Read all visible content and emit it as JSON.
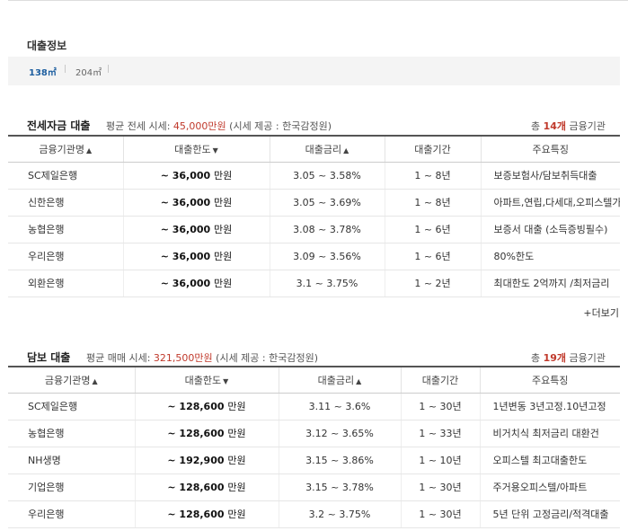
{
  "loan_info": {
    "title": "대출정보",
    "sizes": [
      "138㎡",
      "204㎡"
    ],
    "separator": "|"
  },
  "jeonse": {
    "title": "전세자금 대출",
    "avg_prefix": "평균 전세 시세:",
    "avg_price": "45,000만원",
    "source": "(시세 제공 : 한국감정원)",
    "count_prefix": "총",
    "count": "14개",
    "count_suffix": "금융기관",
    "headers": [
      "금융기관명",
      "대출한도",
      "대출금리",
      "대출기간",
      "주요특징"
    ],
    "rows": [
      {
        "bank": "SC제일은행",
        "limit": "~ 36,000",
        "unit": "만원",
        "rate": "3.05 ~ 3.58%",
        "period": "1 ~ 8년",
        "feature": "보증보험사/담보취득대출"
      },
      {
        "bank": "신한은행",
        "limit": "~ 36,000",
        "unit": "만원",
        "rate": "3.05 ~ 3.69%",
        "period": "1 ~ 8년",
        "feature": "아파트,연립,다세대,오피스텔가능"
      },
      {
        "bank": "농협은행",
        "limit": "~ 36,000",
        "unit": "만원",
        "rate": "3.08 ~ 3.78%",
        "period": "1 ~ 6년",
        "feature": "보증서 대출 (소득증빙필수)"
      },
      {
        "bank": "우리은행",
        "limit": "~ 36,000",
        "unit": "만원",
        "rate": "3.09 ~ 3.56%",
        "period": "1 ~ 6년",
        "feature": "80%한도"
      },
      {
        "bank": "외환은행",
        "limit": "~ 36,000",
        "unit": "만원",
        "rate": "3.1 ~ 3.75%",
        "period": "1 ~ 2년",
        "feature": "최대한도 2억까지 /최저금리"
      }
    ],
    "more": "+더보기"
  },
  "mortgage": {
    "title": "담보 대출",
    "avg_prefix": "평균 매매 시세:",
    "avg_price": "321,500만원",
    "source": "(시세 제공 : 한국감정원)",
    "count_prefix": "총",
    "count": "19개",
    "count_suffix": "금융기관",
    "headers": [
      "금융기관명",
      "대출한도",
      "대출금리",
      "대출기간",
      "주요특징"
    ],
    "rows": [
      {
        "bank": "SC제일은행",
        "limit": "~ 128,600",
        "unit": "만원",
        "rate": "3.11 ~ 3.6%",
        "period": "1 ~ 30년",
        "feature": "1년변동 3년고정.10년고정"
      },
      {
        "bank": "농협은행",
        "limit": "~ 128,600",
        "unit": "만원",
        "rate": "3.12 ~ 3.65%",
        "period": "1 ~ 33년",
        "feature": "비거치식 최저금리 대환건"
      },
      {
        "bank": "NH생명",
        "limit": "~ 192,900",
        "unit": "만원",
        "rate": "3.15 ~ 3.86%",
        "period": "1 ~ 10년",
        "feature": "오피스텔 최고대출한도"
      },
      {
        "bank": "기업은행",
        "limit": "~ 128,600",
        "unit": "만원",
        "rate": "3.15 ~ 3.78%",
        "period": "1 ~ 30년",
        "feature": "주거용오피스텔/아파트"
      },
      {
        "bank": "우리은행",
        "limit": "~ 128,600",
        "unit": "만원",
        "rate": "3.2 ~ 3.75%",
        "period": "1 ~ 30년",
        "feature": "5년 단위 고정금리/적격대출"
      }
    ]
  }
}
